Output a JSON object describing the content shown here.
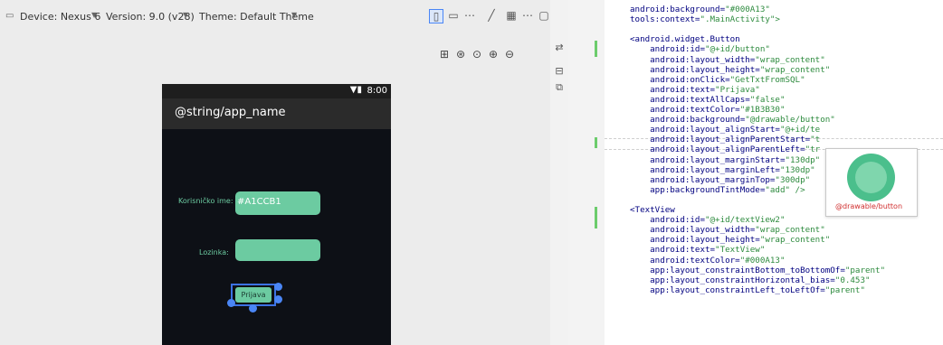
{
  "toolbar": {
    "device_label": "Device: Nexus 6",
    "version_label": "Version: 9.0 (v28)",
    "theme_label": "Theme: Default Theme",
    "device_dropdown_icon": "chevron-down-icon",
    "more_label": "⋯"
  },
  "phone": {
    "status_time": "8:00",
    "app_title": "@string/app_name",
    "username_label": "Korisničko ime:",
    "username_value": "#A1CCB1",
    "password_label": "Lozinka:",
    "button_label": "Prijava"
  },
  "colors": {
    "accent_green": "#6ccba1",
    "phone_bg": "#0d1016",
    "selection_blue": "#3c72e3",
    "string_green": "#2e8b3f"
  },
  "editor": {
    "lines": [
      [
        "android:background=",
        "\"#000A13\""
      ],
      [
        "tools:context=",
        "\".MainActivity\">"
      ],
      [
        "",
        ""
      ],
      [
        "<android.widget.Button",
        ""
      ],
      [
        "    android:id=",
        "\"@+id/button\""
      ],
      [
        "    android:layout_width=",
        "\"wrap_content\""
      ],
      [
        "    android:layout_height=",
        "\"wrap_content\""
      ],
      [
        "    android:onClick=",
        "\"GetTxtFromSQL\""
      ],
      [
        "    android:text=",
        "\"Prijava\""
      ],
      [
        "    android:textAllCaps=",
        "\"false\""
      ],
      [
        "    android:textColor=",
        "\"#1B3B30\""
      ],
      [
        "    android:background=",
        "\"@drawable/button\""
      ],
      [
        "    android:layout_alignStart=",
        "\"@+id/te"
      ],
      [
        "    android:layout_alignParentStart=",
        "\"t"
      ],
      [
        "    android:layout_alignParentLeft=",
        "\"tr"
      ],
      [
        "    android:layout_marginStart=",
        "\"130dp\""
      ],
      [
        "    android:layout_marginLeft=",
        "\"130dp\""
      ],
      [
        "    android:layout_marginTop=",
        "\"300dp\""
      ],
      [
        "    app:backgroundTintMode=",
        "\"add\" />"
      ],
      [
        "",
        ""
      ],
      [
        "<TextView",
        ""
      ],
      [
        "    android:id=",
        "\"@+id/textView2\""
      ],
      [
        "    android:layout_width=",
        "\"wrap_content\""
      ],
      [
        "    android:layout_height=",
        "\"wrap_content\""
      ],
      [
        "    android:text=",
        "\"TextView\""
      ],
      [
        "    android:textColor=",
        "\"#000A13\""
      ],
      [
        "    app:layout_constraintBottom_toBottomOf=",
        "\"parent\""
      ],
      [
        "    app:layout_constraintHorizontal_bias=",
        "\"0.453\""
      ],
      [
        "    app:layout_constraintLeft_toLeftOf=",
        "\"parent\""
      ]
    ]
  },
  "popup": {
    "label": "@drawable/button"
  }
}
